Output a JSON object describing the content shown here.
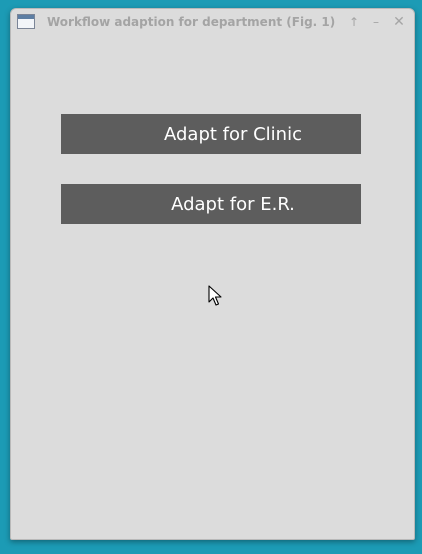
{
  "window": {
    "title": "Workflow adaption for department (Fig. 1)",
    "icons": [
      "app-window-icon",
      "arrow-up-icon",
      "minimize-icon",
      "close-icon"
    ]
  },
  "titlebar_buttons": {
    "up": "↑",
    "minimize": "–",
    "close": "✕"
  },
  "buttons": {
    "clinic": "Adapt for Clinic",
    "er": "Adapt for E.R."
  },
  "colors": {
    "desktop": "#1c9bb5",
    "window_bg": "#dcdcdc",
    "button_bg": "#5d5d5d",
    "button_text": "#ffffff"
  }
}
